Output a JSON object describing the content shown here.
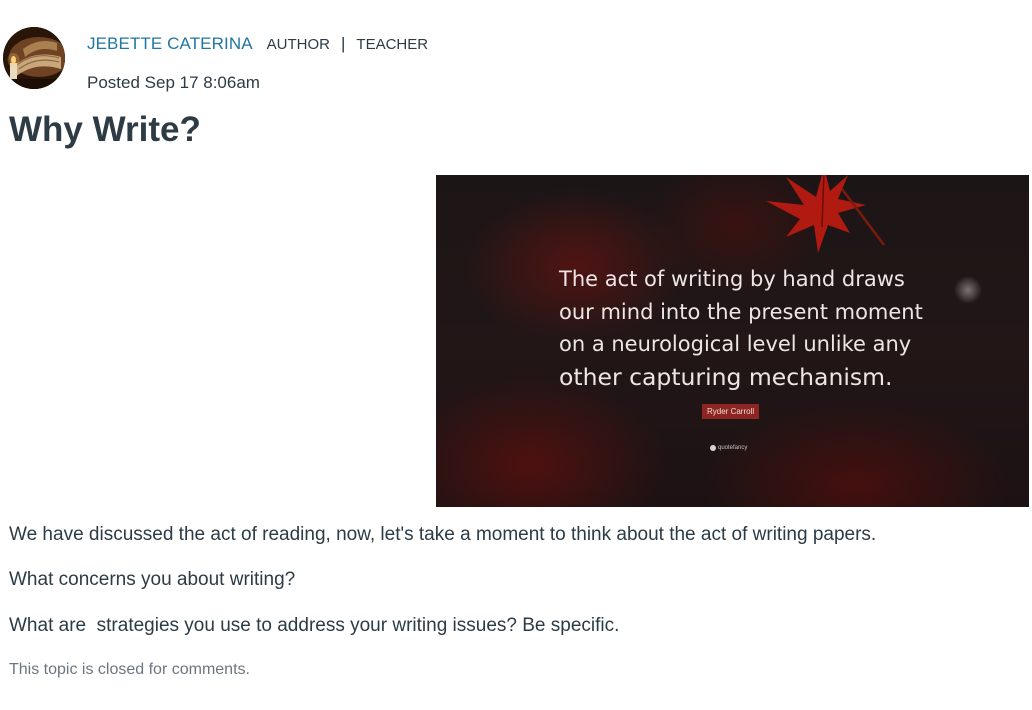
{
  "post": {
    "author_name": "JEBETTE CATERINA",
    "roles": [
      "AUTHOR",
      "TEACHER"
    ],
    "role_separator": "|",
    "posted": "Posted Sep 17 8:06am",
    "title": "Why Write?"
  },
  "image": {
    "quote_lines": [
      "The act of writing by hand draws",
      "our mind into the present moment",
      "on a neurological level unlike any",
      "other capturing mechanism."
    ],
    "quote_author": "Ryder Carroll",
    "watermark": "quotefancy"
  },
  "body": {
    "paragraphs": [
      "We have discussed the act of reading, now, let's take a moment to think about the act of writing papers.",
      "What concerns you about writing?",
      "What are  strategies you use to address your writing issues? Be specific."
    ]
  },
  "footer": {
    "closed_note": "This topic is closed for comments."
  },
  "colors": {
    "author_link": "#2276a3",
    "text": "#2d3b45",
    "muted": "#6b7780",
    "quote_badge": "#8c2622"
  },
  "icons": {
    "avatar": "author-avatar-book-candle",
    "leaf": "red-leaf-icon"
  }
}
